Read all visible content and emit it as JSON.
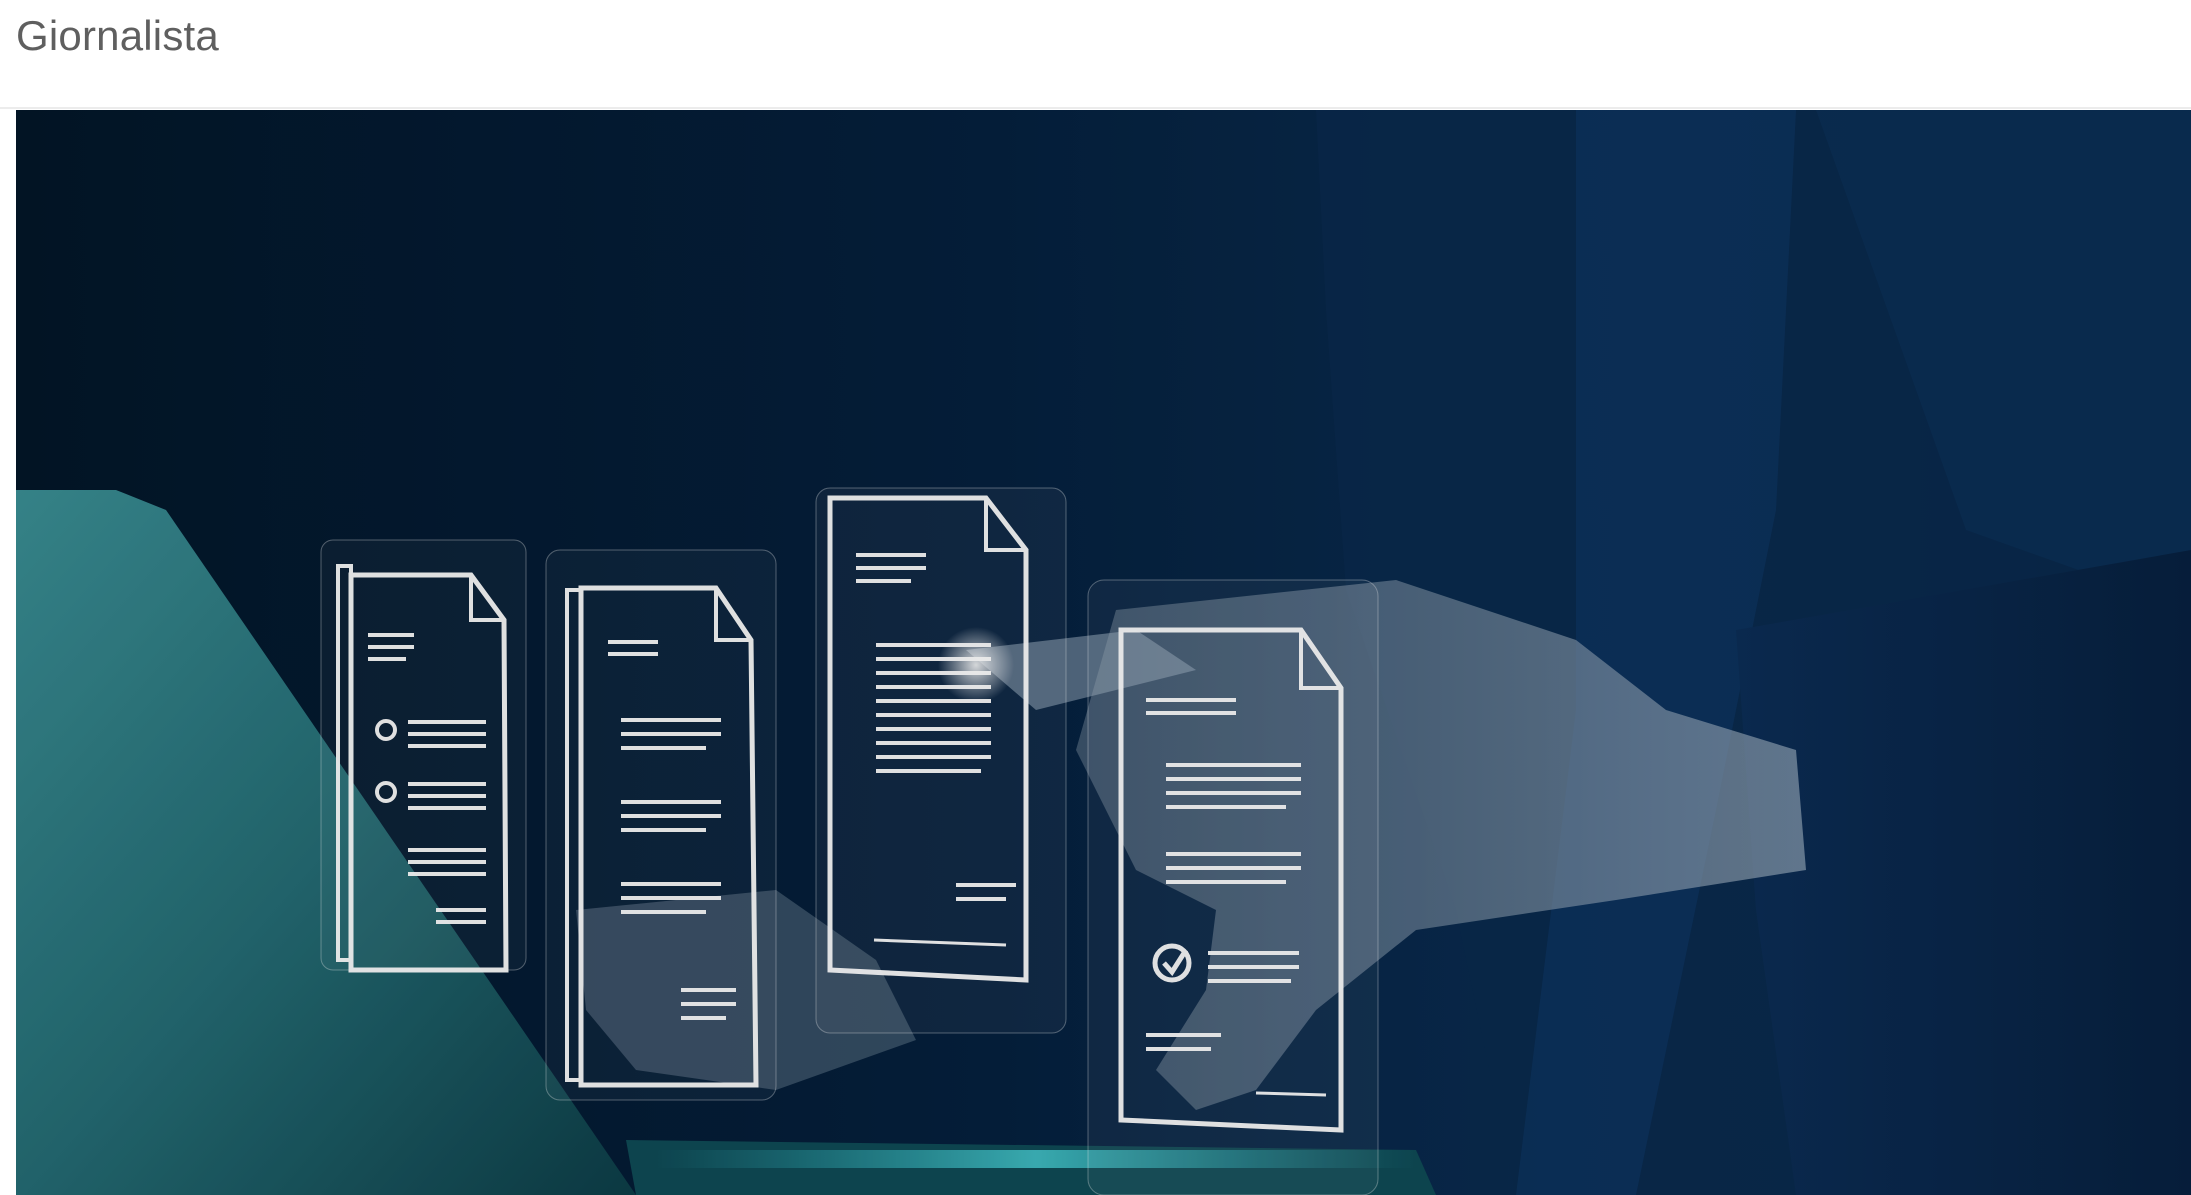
{
  "header": {
    "title": "Giornalista"
  },
  "hero": {
    "image_icon": "document-scanning-illustration",
    "colors": {
      "background": "#041a33",
      "glow": "#ffffff",
      "laptop": "#2e7f86"
    }
  }
}
